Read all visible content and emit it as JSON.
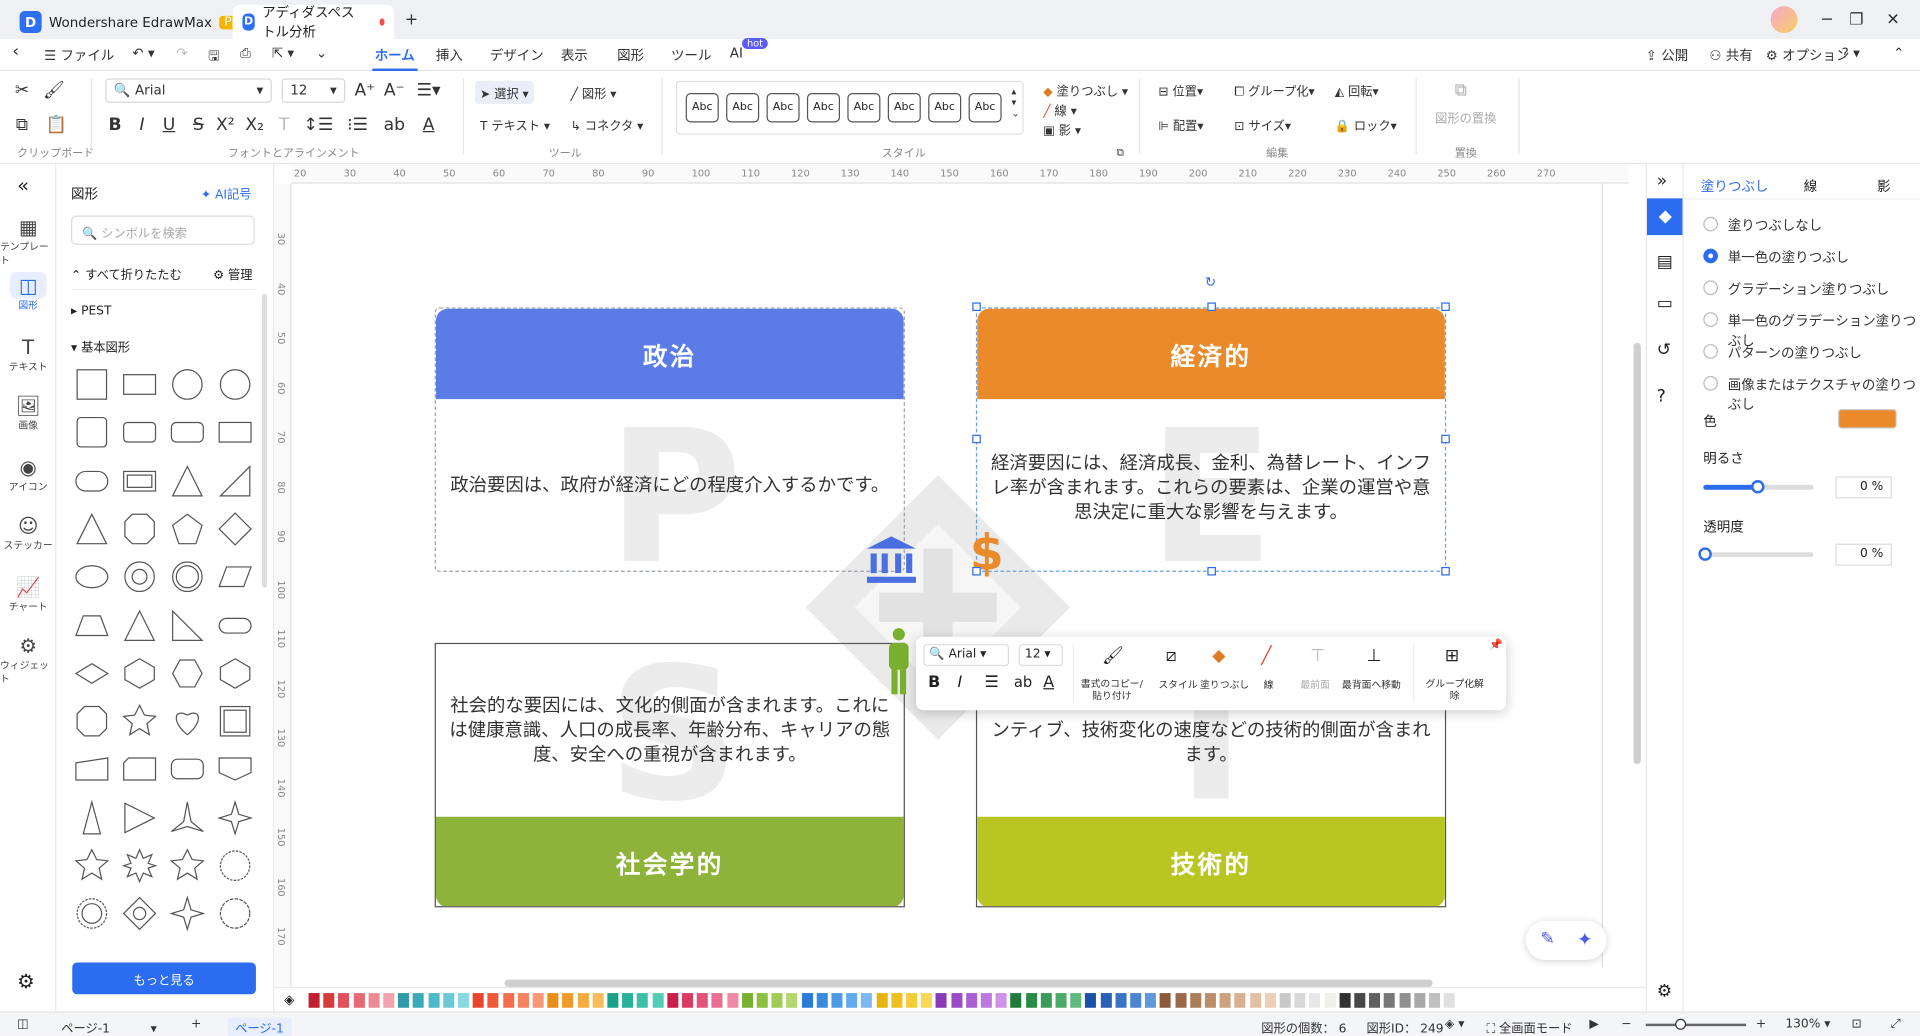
{
  "titlebar": {
    "app_name": "Wondershare EdrawMax",
    "pro_badge": "Pro",
    "doc_tab": "アディダスペストル分析"
  },
  "menu": {
    "file": "ファイル",
    "tabs": [
      "ホーム",
      "挿入",
      "デザイン",
      "表示",
      "図形",
      "ツール",
      "AI"
    ],
    "ai_badge": "hot",
    "publish": "公開",
    "share": "共有",
    "options": "オプション"
  },
  "ribbon": {
    "font_name": "Arial",
    "font_size": "12",
    "select": "選択",
    "shape": "図形",
    "text": "テキスト",
    "connector": "コネクタ",
    "style_sample": "Abc",
    "fill": "塗りつぶし",
    "line": "線",
    "shadow": "影",
    "position": "位置",
    "group": "グループ化",
    "rotate": "回転",
    "align": "配置",
    "size": "サイズ",
    "lock": "ロック",
    "replace": "図形の置換",
    "groups": [
      "クリップボード",
      "フォントとアラインメント",
      "ツール",
      "スタイル",
      "編集",
      "置換"
    ]
  },
  "leftrail": [
    "テンプレート",
    "図形",
    "テキスト",
    "画像",
    "アイコン",
    "ステッカー",
    "チャート",
    "ウィジェット"
  ],
  "shapes_panel": {
    "title": "図形",
    "ai_link": "AI記号",
    "search_placeholder": "シンボルを検索",
    "collapse_all": "すべて折りたたむ",
    "manage": "管理",
    "cat_pest": "PEST",
    "cat_basic": "基本図形",
    "more_button": "もっと見る"
  },
  "ruler": {
    "top": [
      "20",
      "30",
      "40",
      "50",
      "60",
      "70",
      "80",
      "90",
      "100",
      "110",
      "120",
      "130",
      "140",
      "150",
      "160",
      "170",
      "180",
      "190",
      "200",
      "210",
      "220",
      "230",
      "240",
      "250",
      "260",
      "270"
    ],
    "left": [
      "30",
      "40",
      "50",
      "60",
      "70",
      "80",
      "90",
      "100",
      "110",
      "120",
      "130",
      "140",
      "150",
      "160",
      "170"
    ]
  },
  "diagram": {
    "politics": {
      "title": "政治",
      "letter": "P",
      "body": "政治要因は、政府が経済にどの程度介入するかです。",
      "color": "#5b7be6"
    },
    "economic": {
      "title": "経済的",
      "letter": "E",
      "body": "経済要因には、経済成長、金利、為替レート、インフレ率が含まれます。これらの要素は、企業の運営や意思決定に重大な影響を与えます。",
      "color": "#ea8a2a"
    },
    "social": {
      "title": "社会学的",
      "letter": "S",
      "body": "社会的な要因には、文化的側面が含まれます。これには健康意識、人口の成長率、年齢分布、キャリアの態度、安全への重視が含まれます。",
      "color": "#8db33a"
    },
    "technology": {
      "title": "技術的",
      "letter": "T",
      "body": "ンティブ、技術変化の速度などの技術的側面が含まれます。",
      "color": "#b9c520"
    }
  },
  "floatbar": {
    "font_name": "Arial",
    "font_size": "12",
    "format_copy": "書式のコピー/貼り付け",
    "style": "スタイル",
    "fill": "塗りつぶし",
    "line": "線",
    "front": "最前面",
    "back": "最背面へ移動",
    "ungroup": "グループ化解除"
  },
  "rightpanel": {
    "tabs": [
      "塗りつぶし",
      "線",
      "影"
    ],
    "options": [
      "塗りつぶしなし",
      "単一色の塗りつぶし",
      "グラデーション塗りつぶし",
      "単一色のグラデーション塗りつぶし",
      "パターンの塗りつぶし",
      "画像またはテクスチャの塗りつぶし"
    ],
    "selected_option": 1,
    "color_label": "色",
    "color_value": "#ea8a2a",
    "brightness_label": "明るさ",
    "brightness_value": "0 %",
    "transparency_label": "透明度",
    "transparency_value": "0 %"
  },
  "status": {
    "page_select": "ページ-1",
    "page_tab": "ページ-1",
    "shape_count": "図形の個数： 6",
    "shape_id": "図形ID： 249",
    "fullscreen": "全画面モード",
    "zoom": "130%"
  },
  "palette": [
    "#c0202f",
    "#d93a3a",
    "#e0505a",
    "#e66a74",
    "#ee8a95",
    "#f2a3ad",
    "#2f9aa8",
    "#3aaab8",
    "#4cbac6",
    "#6acad4",
    "#8ad8e0",
    "#e8462a",
    "#ee5a3a",
    "#f26e4c",
    "#f58362",
    "#f89878",
    "#e98d1a",
    "#f09c2a",
    "#f3ac40",
    "#f6bd5a",
    "#1aa08a",
    "#28b09a",
    "#3cc0aa",
    "#55ccb8",
    "#c8204a",
    "#d83a62",
    "#e2547a",
    "#ea6e90",
    "#f088a6",
    "#7ab030",
    "#8cc040",
    "#9ecc55",
    "#b0d86c",
    "#2a7ad8",
    "#3a8ae0",
    "#4c9ae6",
    "#62aaec",
    "#7abaf0",
    "#e6b410",
    "#f0c020",
    "#f4cc38",
    "#f8d855",
    "#8a3ab8",
    "#9a4cc8",
    "#aa60d4",
    "#bc78de",
    "#ce92e8",
    "#207a3a",
    "#2a8a48",
    "#3a9a58",
    "#4caa6a",
    "#60ba7e",
    "#1a50a8",
    "#2a60b8",
    "#3a72c6",
    "#4c84d2",
    "#6098dc",
    "#8a5a3a",
    "#9a6a48",
    "#aa7c58",
    "#bc8e6a",
    "#cea27e",
    "#d8b090",
    "#e2c0a4",
    "#eccfb8",
    "#c8c8c8",
    "#d8d8d8",
    "#e8e8e8",
    "#f0f0e8",
    "#303030",
    "#484848",
    "#606060",
    "#787878",
    "#909090",
    "#a8a8a8",
    "#c0c0c0",
    "#e0e0e0"
  ]
}
